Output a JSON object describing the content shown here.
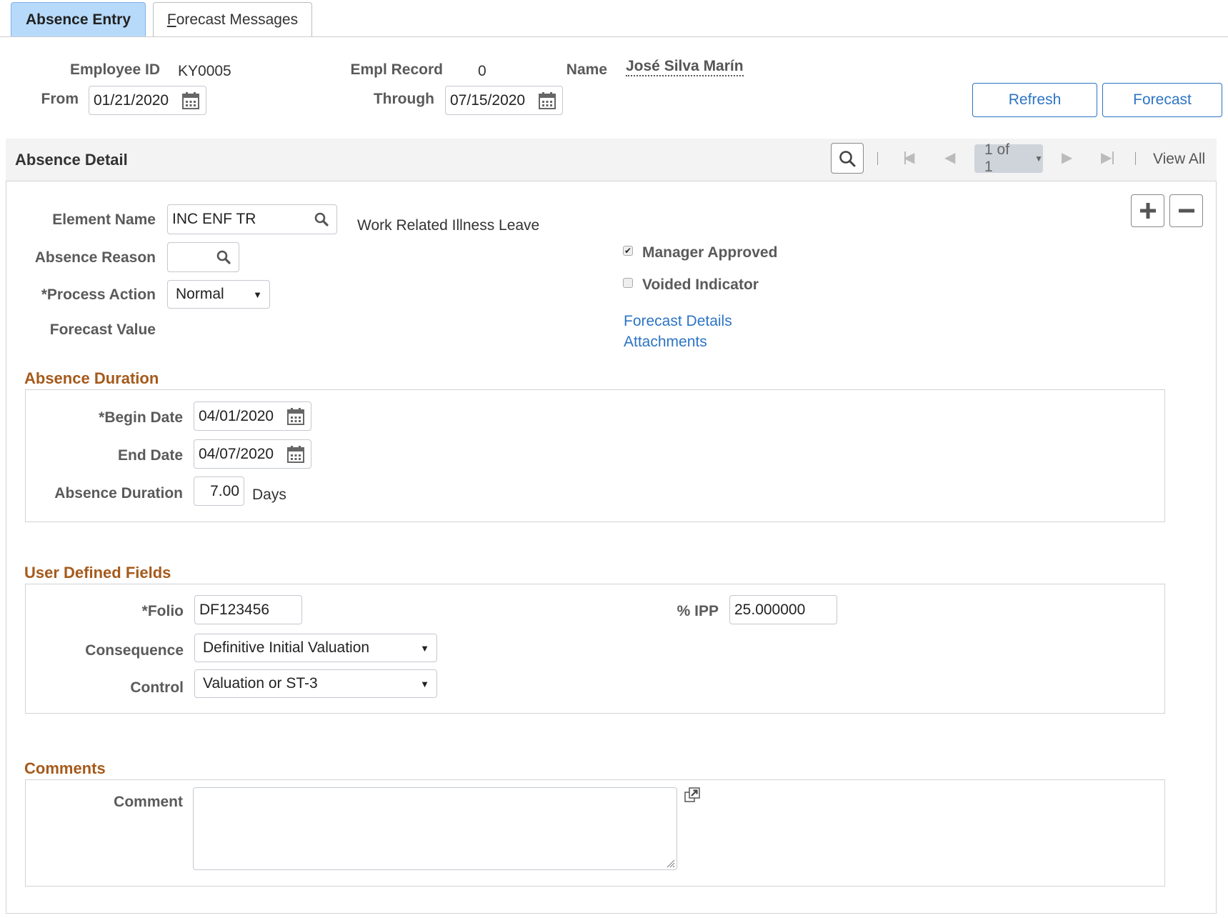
{
  "tabs": [
    {
      "label": "Absence Entry",
      "active": true
    },
    {
      "label_first": "F",
      "label_rest": "orecast Messages",
      "label": "Forecast Messages",
      "active": false
    }
  ],
  "header": {
    "employee_id_label": "Employee ID",
    "employee_id": "KY0005",
    "empl_record_label": "Empl Record",
    "empl_record": "0",
    "name_label": "Name",
    "name": "José Silva Marín",
    "from_label": "From",
    "from_date": "01/21/2020",
    "through_label": "Through",
    "through_date": "07/15/2020",
    "refresh_label": "Refresh",
    "forecast_label": "Forecast"
  },
  "absence_detail": {
    "title": "Absence Detail",
    "pager_text": "1 of 1",
    "view_all": "View All",
    "element_name_label": "Element Name",
    "element_name": "INC ENF TR",
    "element_description": "Work Related Illness Leave",
    "absence_reason_label": "Absence Reason",
    "absence_reason": "",
    "process_action_label": "*Process Action",
    "process_action": "Normal",
    "forecast_value_label": "Forecast Value",
    "manager_approved_label": "Manager Approved",
    "manager_approved": true,
    "voided_indicator_label": "Voided Indicator",
    "voided_indicator": false,
    "forecast_details_link": "Forecast Details",
    "attachments_link": "Attachments"
  },
  "absence_duration": {
    "title": "Absence Duration",
    "begin_date_label": "*Begin Date",
    "begin_date": "04/01/2020",
    "end_date_label": "End Date",
    "end_date": "04/07/2020",
    "duration_label": "Absence Duration",
    "duration": "7.00",
    "duration_unit": "Days"
  },
  "user_defined": {
    "title": "User Defined Fields",
    "folio_label": "*Folio",
    "folio": "DF123456",
    "ipp_label": "% IPP",
    "ipp": "25.000000",
    "consequence_label": "Consequence",
    "consequence": "Definitive Initial Valuation",
    "control_label": "Control",
    "control": "Valuation or ST-3"
  },
  "comments": {
    "title": "Comments",
    "comment_label": "Comment",
    "comment": ""
  },
  "colors": {
    "accent_link": "#2d74c4",
    "section_title": "#a55a1b",
    "active_tab": "#b7dafa"
  }
}
